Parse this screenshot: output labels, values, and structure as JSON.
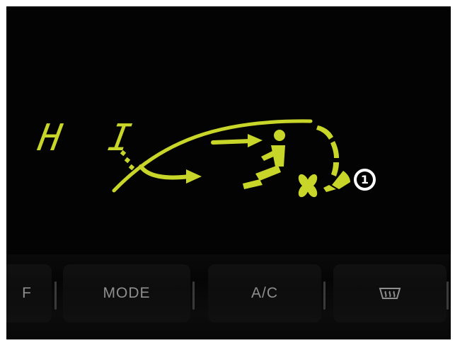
{
  "display": {
    "fan_speed_label": "H I",
    "marker_label": "1",
    "colors": {
      "lcd_segment": "#c8d62a",
      "background": "#030303",
      "button_label": "#8e8e8e"
    },
    "indicators": {
      "airflow_mode": "face-and-floor",
      "fan_icon": "fan-icon",
      "fan_level_fraction": 1.0
    }
  },
  "buttons": {
    "partial_label": "F",
    "mode_label": "MODE",
    "ac_label": "A/C",
    "defrost_icon": "rear-defrost-icon"
  }
}
